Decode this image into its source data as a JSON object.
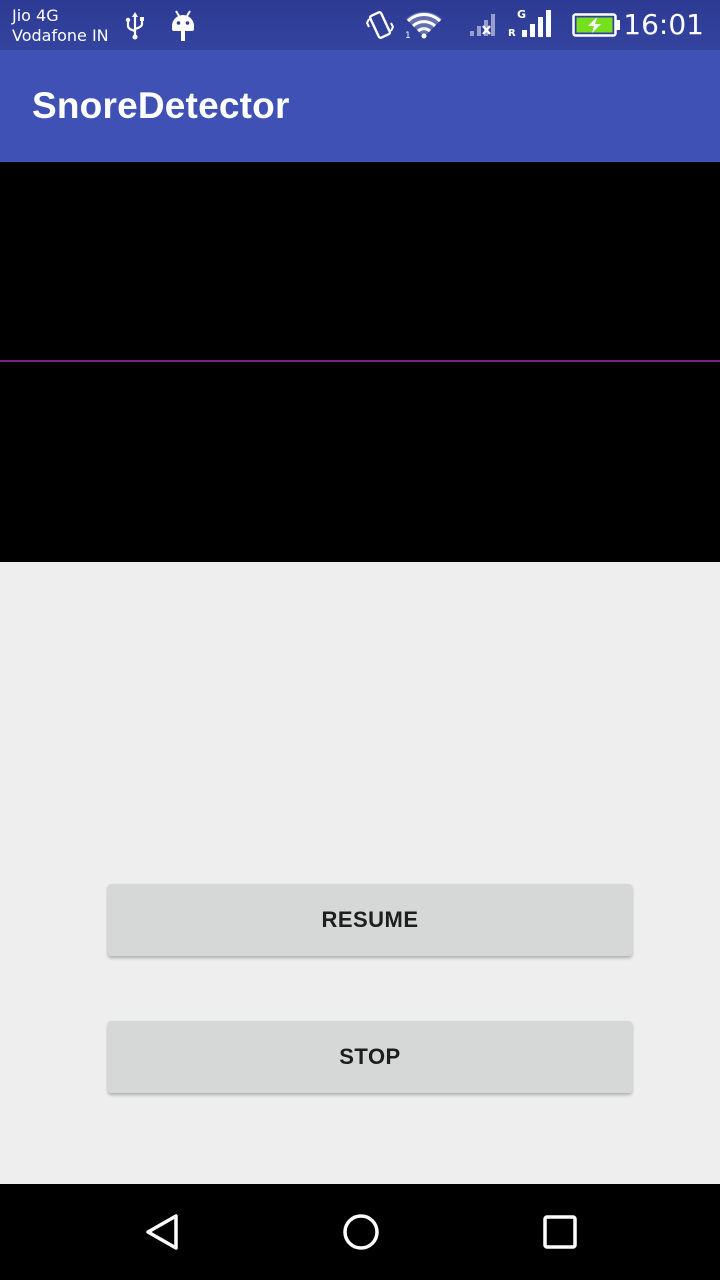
{
  "status_bar": {
    "carrier_1": "Jio 4G",
    "carrier_2": "Vodafone IN",
    "time": "16:01",
    "icons": [
      "usb-icon",
      "android-debug-icon",
      "vibrate-icon",
      "wifi-icon",
      "signal-no-service-icon",
      "signal-roaming-icon",
      "battery-charging-icon"
    ],
    "battery_color": "#76e01f"
  },
  "app_bar": {
    "title": "SnoreDetector",
    "color": "#3f51b5"
  },
  "waveform": {
    "background": "#000000",
    "line_color": "#7b1f8a"
  },
  "controls": {
    "resume_label": "RESUME",
    "stop_label": "STOP"
  },
  "nav_bar": {
    "icons": [
      "back-icon",
      "home-icon",
      "recents-icon"
    ]
  }
}
